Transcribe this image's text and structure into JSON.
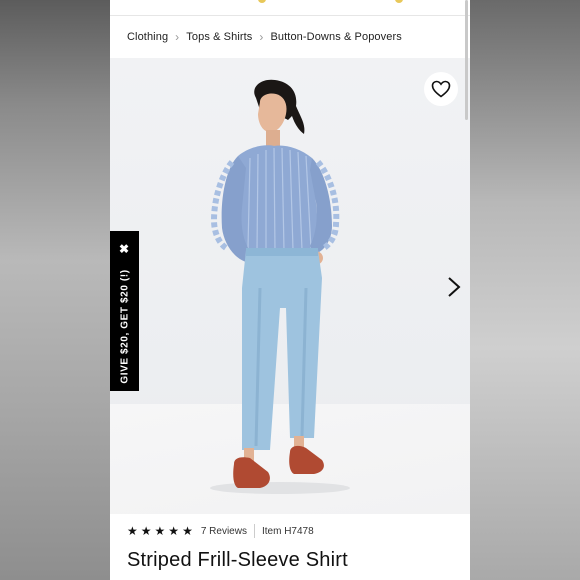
{
  "breadcrumb": {
    "items": [
      "Clothing",
      "Tops & Shirts",
      "Button-Downs & Popovers"
    ]
  },
  "promo": {
    "label": "GIVE $20, GET $20 (!)",
    "close_glyph": "✖"
  },
  "product": {
    "rating_stars": 5,
    "reviews": "7 Reviews",
    "item": "Item H7478",
    "title": "Striped Frill-Sleeve Shirt"
  },
  "icons": {
    "wishlist": "heart-icon",
    "next": "chevron-right-icon",
    "breadcrumb_separator": "chevron-right-icon"
  },
  "colors": {
    "promo_bg": "#000000",
    "shirt": "#8fa9d4",
    "jeans": "#9ec3df",
    "shoes": "#b04a32"
  }
}
